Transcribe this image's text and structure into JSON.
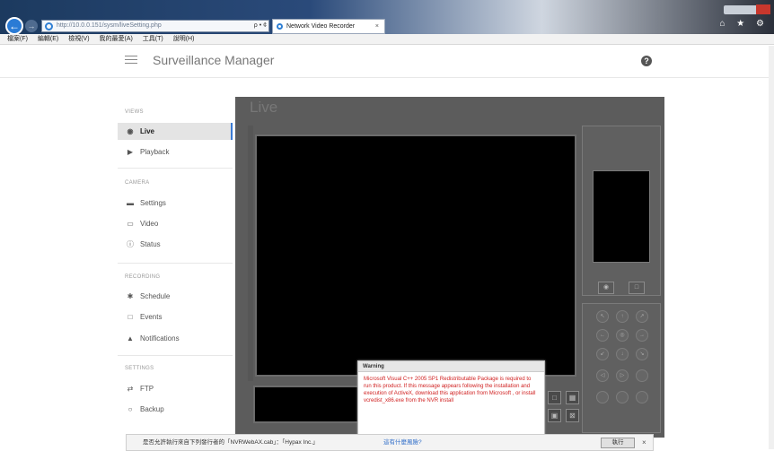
{
  "browser": {
    "address_url": "http://10.0.0.151/sysm/liveSetting.php",
    "address_controls": "ρ • ¢",
    "tab_title": "Network Video Recorder",
    "tab_close": "×",
    "back_glyph": "←",
    "forward_glyph": "→",
    "toolbar_icons": "⌂ ★ ⚙",
    "menu": [
      "檔案(F)",
      "編輯(E)",
      "檢視(V)",
      "我的最愛(A)",
      "工具(T)",
      "說明(H)"
    ]
  },
  "header": {
    "title": "Surveillance Manager",
    "help_glyph": "?"
  },
  "sidebar": {
    "sections": [
      {
        "title": "VIEWS",
        "items": [
          {
            "label": "Live",
            "icon": "eye-icon",
            "glyph": "◉"
          },
          {
            "label": "Playback",
            "icon": "play-icon",
            "glyph": "▶"
          }
        ]
      },
      {
        "title": "CAMERA",
        "items": [
          {
            "label": "Settings",
            "icon": "camera-settings-icon",
            "glyph": "▬"
          },
          {
            "label": "Video",
            "icon": "video-icon",
            "glyph": "▭"
          },
          {
            "label": "Status",
            "icon": "info-icon",
            "glyph": "ⓘ"
          }
        ]
      },
      {
        "title": "RECORDING",
        "items": [
          {
            "label": "Schedule",
            "icon": "gear-icon",
            "glyph": "✱"
          },
          {
            "label": "Events",
            "icon": "calendar-icon",
            "glyph": "□"
          },
          {
            "label": "Notifications",
            "icon": "bell-icon",
            "glyph": "▲"
          }
        ]
      },
      {
        "title": "SETTINGS",
        "items": [
          {
            "label": "FTP",
            "icon": "ftp-icon",
            "glyph": "⇄"
          },
          {
            "label": "Backup",
            "icon": "backup-icon",
            "glyph": "○"
          }
        ]
      }
    ]
  },
  "main": {
    "title": "Live"
  },
  "ptz": {
    "row1": [
      "↖",
      "↑",
      "↗"
    ],
    "row2": [
      "←",
      "◎",
      "→"
    ],
    "row3": [
      "↙",
      "↓",
      "↘"
    ],
    "zoom": [
      "◁",
      "▷"
    ]
  },
  "warning": {
    "title": "Warning",
    "message": "Microsoft Visual C++ 2005 SP1 Redistributable Package is required to run this product. If this message appears following the installation and execution of ActiveX, download this application from Microsoft , or install vcredist_x86.exe from the NVR install"
  },
  "notification": {
    "text": "是否允許執行來自下列發行者的「NVRWebAX.cab」：「Hypax Inc.」",
    "link": "這有什麼風險?",
    "button": "執行",
    "close": "×"
  }
}
